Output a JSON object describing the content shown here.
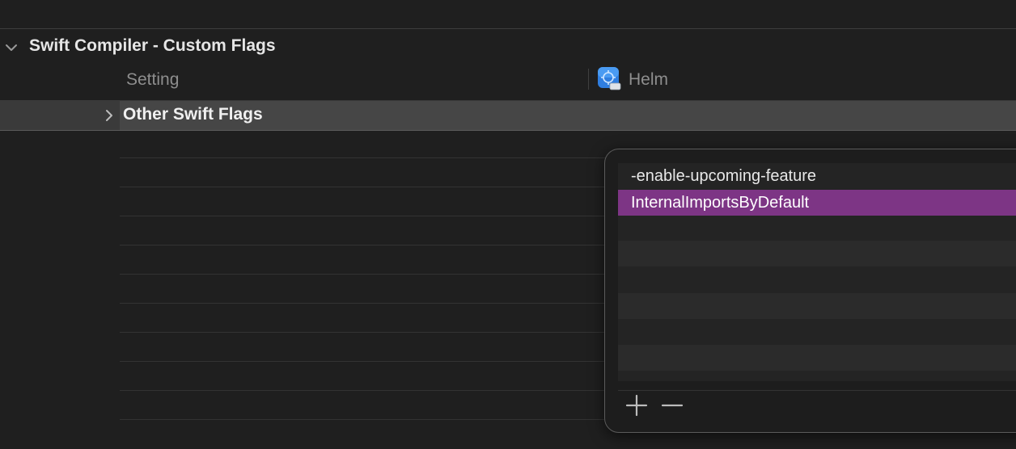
{
  "section": {
    "title": "Swift Compiler - Custom Flags",
    "chevron_icon": "chevron-down-icon"
  },
  "columns": {
    "setting": "Setting",
    "target": "Helm",
    "target_icon": "app-target-icon"
  },
  "selected_setting": {
    "label": "Other Swift Flags",
    "chevron_icon": "chevron-right-icon"
  },
  "popover": {
    "items": [
      "-enable-upcoming-feature",
      "InternalImportsByDefault"
    ],
    "selected_index": 1,
    "add_icon": "plus-icon",
    "remove_icon": "minus-icon"
  },
  "colors": {
    "selection": "#7d3585",
    "background": "#1f1f1f",
    "row_highlight": "#464646"
  }
}
